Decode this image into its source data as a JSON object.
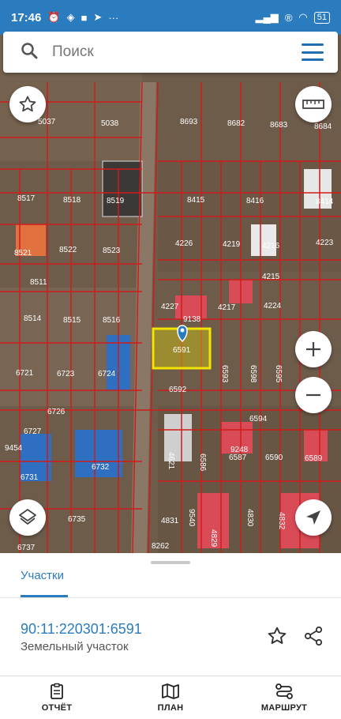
{
  "status_bar": {
    "time": "17:46",
    "battery": "51"
  },
  "search": {
    "placeholder": "Поиск"
  },
  "map": {
    "parcels": [
      {
        "id": "5037"
      },
      {
        "id": "5038"
      },
      {
        "id": "8693"
      },
      {
        "id": "8682"
      },
      {
        "id": "8683"
      },
      {
        "id": "8684"
      },
      {
        "id": "8517"
      },
      {
        "id": "8518"
      },
      {
        "id": "8519"
      },
      {
        "id": "8415"
      },
      {
        "id": "8416"
      },
      {
        "id": "8414"
      },
      {
        "id": "8521"
      },
      {
        "id": "8522"
      },
      {
        "id": "8523"
      },
      {
        "id": "4226"
      },
      {
        "id": "4219"
      },
      {
        "id": "4216"
      },
      {
        "id": "4223"
      },
      {
        "id": "8511"
      },
      {
        "id": "4215"
      },
      {
        "id": "4227"
      },
      {
        "id": "4217"
      },
      {
        "id": "4224"
      },
      {
        "id": "8514"
      },
      {
        "id": "8515"
      },
      {
        "id": "8516"
      },
      {
        "id": "9138"
      },
      {
        "id": "6721"
      },
      {
        "id": "6723"
      },
      {
        "id": "6724"
      },
      {
        "id": "6592"
      },
      {
        "id": "6593"
      },
      {
        "id": "6598"
      },
      {
        "id": "6595"
      },
      {
        "id": "6726"
      },
      {
        "id": "6594"
      },
      {
        "id": "6727"
      },
      {
        "id": "9454"
      },
      {
        "id": "6731"
      },
      {
        "id": "6732"
      },
      {
        "id": "4621"
      },
      {
        "id": "6586"
      },
      {
        "id": "6587"
      },
      {
        "id": "9248"
      },
      {
        "id": "6590"
      },
      {
        "id": "6589"
      },
      {
        "id": "6735"
      },
      {
        "id": "4831"
      },
      {
        "id": "9540"
      },
      {
        "id": "4830"
      },
      {
        "id": "4832"
      },
      {
        "id": "4829"
      },
      {
        "id": "6737"
      },
      {
        "id": "8262"
      }
    ],
    "selected_parcel_label": "6591"
  },
  "sheet": {
    "tab_label": "Участки",
    "cadastral_number": "90:11:220301:6591",
    "object_type": "Земельный участок"
  },
  "nav": {
    "report": "ОТЧЁТ",
    "plan": "ПЛАН",
    "route": "МАРШРУТ"
  },
  "colors": {
    "accent": "#2b7bbf",
    "parcel_border": "#d01c1c",
    "selected_parcel": "#f2e400"
  }
}
